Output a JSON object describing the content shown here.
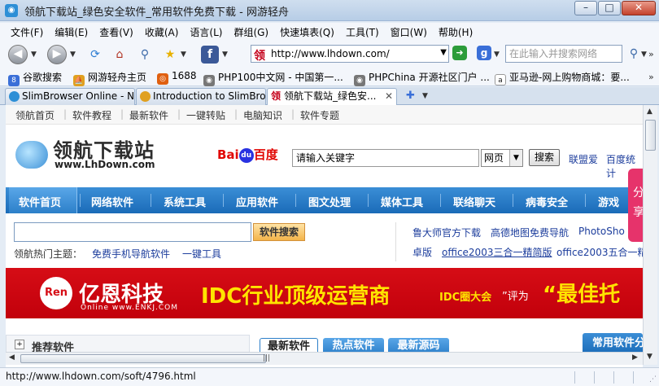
{
  "window": {
    "title": "领航下载站_绿色安全软件_常用软件免费下载 - 网游轻舟",
    "min": "–",
    "max": "□",
    "close": "✕"
  },
  "menu": [
    "文件(F)",
    "编辑(E)",
    "查看(V)",
    "收藏(A)",
    "语言(L)",
    "群组(G)",
    "快速填表(Q)",
    "工具(T)",
    "窗口(W)",
    "帮助(H)"
  ],
  "nav": {
    "address_icon": "领",
    "address": "http://www.lhdown.com/",
    "search_placeholder": "在此输入并搜索网络",
    "search_engine": "g"
  },
  "favorites": [
    {
      "label": "谷歌搜索",
      "color": "#3a6fd8"
    },
    {
      "label": "网游轻舟主页",
      "color": "#e0a020"
    },
    {
      "label": "1688",
      "color": "#e06010"
    },
    {
      "label": "PHP100中文网 - 中国第一...",
      "color": "#666666"
    },
    {
      "label": "PHPChina 开源社区门户 ...",
      "color": "#666666"
    },
    {
      "label": "亚马逊-网上购物商城：要...",
      "color": "#333333"
    }
  ],
  "tabs": [
    {
      "label": "SlimBrowser Online - N...",
      "close": "✕"
    },
    {
      "label": "Introduction to SlimBro...",
      "close": "✕"
    },
    {
      "label": "领航下载站_绿色安...",
      "close": "✕"
    }
  ],
  "site": {
    "topnav": [
      "领航首页",
      "软件教程",
      "最新软件",
      "一键转贴",
      "电脑知识",
      "软件专题"
    ],
    "logo_zh": "领航下载站",
    "logo_en": "www.LhDown.com",
    "baidu_a": "Bai",
    "baidu_paw": "du",
    "baidu_b": "百度",
    "baidu_input": "请输入关键字",
    "baidu_select": "网页",
    "baidu_button": "搜索",
    "baidu_links": [
      "联盟爱",
      "百度统计"
    ],
    "categories": [
      "软件首页",
      "网络软件",
      "系统工具",
      "应用软件",
      "图文处理",
      "媒体工具",
      "联络聊天",
      "病毒安全",
      "游戏"
    ],
    "share": [
      "分",
      "享"
    ],
    "search_button": "软件搜索",
    "hot_label": "领航热门主题：",
    "hot_links": [
      "免费手机导航软件",
      "一键工具"
    ],
    "right_links_1": [
      "鲁大师官方下载",
      "高德地图免费导航",
      "PhotoSho"
    ],
    "right_links_2": [
      "卓版",
      "office2003三合一精简版",
      "office2003五合一精"
    ],
    "banner": {
      "logo": "Ren",
      "company": "亿恩科技",
      "company_url": "Online  www.ENKJ.COM",
      "slogan": "IDC行业顶级运营商",
      "idc_a": "IDC圈大会",
      "idc_b": "”评为",
      "idc_c": "“最佳托"
    },
    "recommend": "推荐软件",
    "sub_tabs": [
      "最新软件",
      "热点软件",
      "最新源码"
    ],
    "right_tab": "常用软件分"
  },
  "status": "http://www.lhdown.com/soft/4796.html"
}
